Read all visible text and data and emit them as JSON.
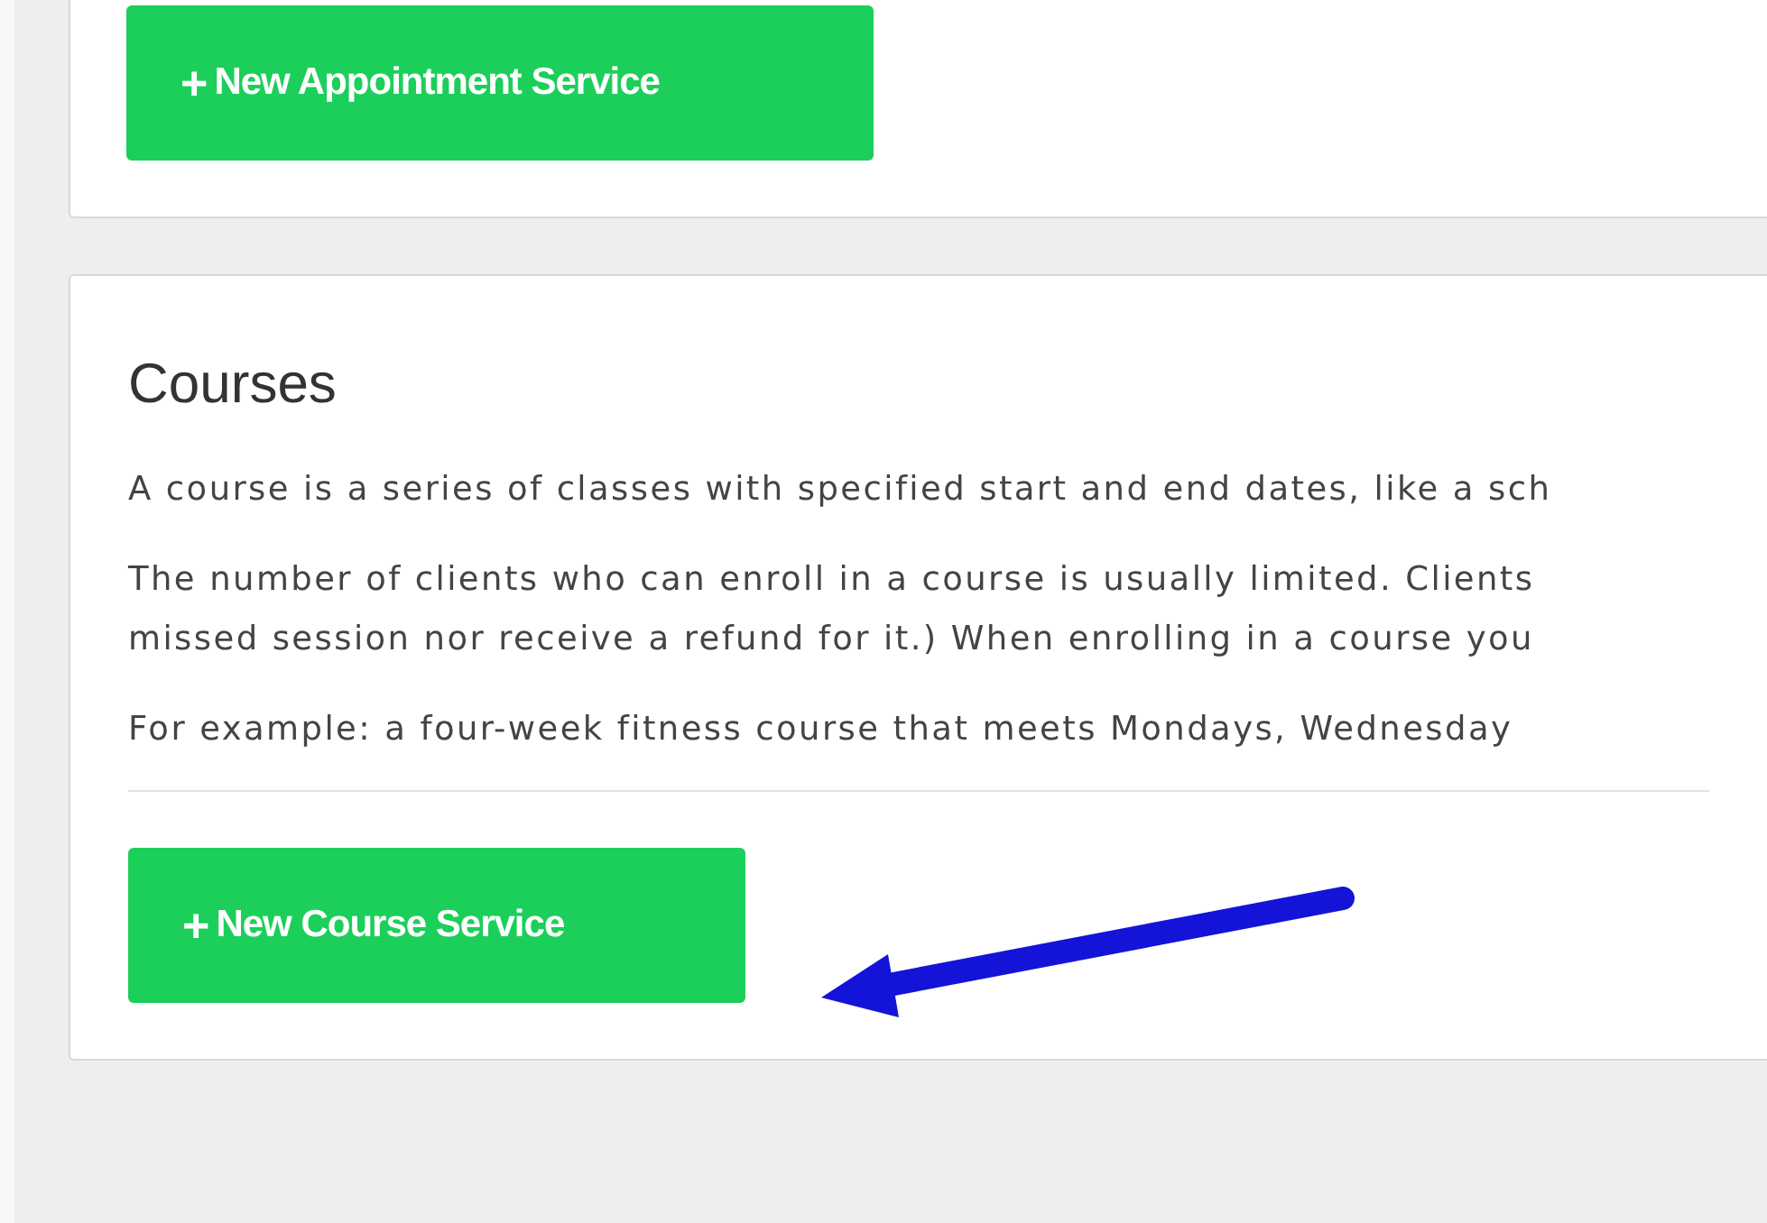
{
  "appointments": {
    "button": {
      "icon": "+",
      "label": "New Appointment Service"
    }
  },
  "courses": {
    "title": "Courses",
    "paragraphs": [
      {
        "lines": [
          "A course is a series of classes with specified start and end dates, like a sch"
        ]
      },
      {
        "lines": [
          "The number of clients who can enroll in a course is usually limited. Clients",
          "missed session nor receive a refund for it.) When enrolling in a course you"
        ]
      },
      {
        "lines": [
          "For example: a four-week fitness course that meets Mondays, Wednesday"
        ]
      }
    ],
    "button": {
      "icon": "+",
      "label": "New Course Service"
    }
  }
}
